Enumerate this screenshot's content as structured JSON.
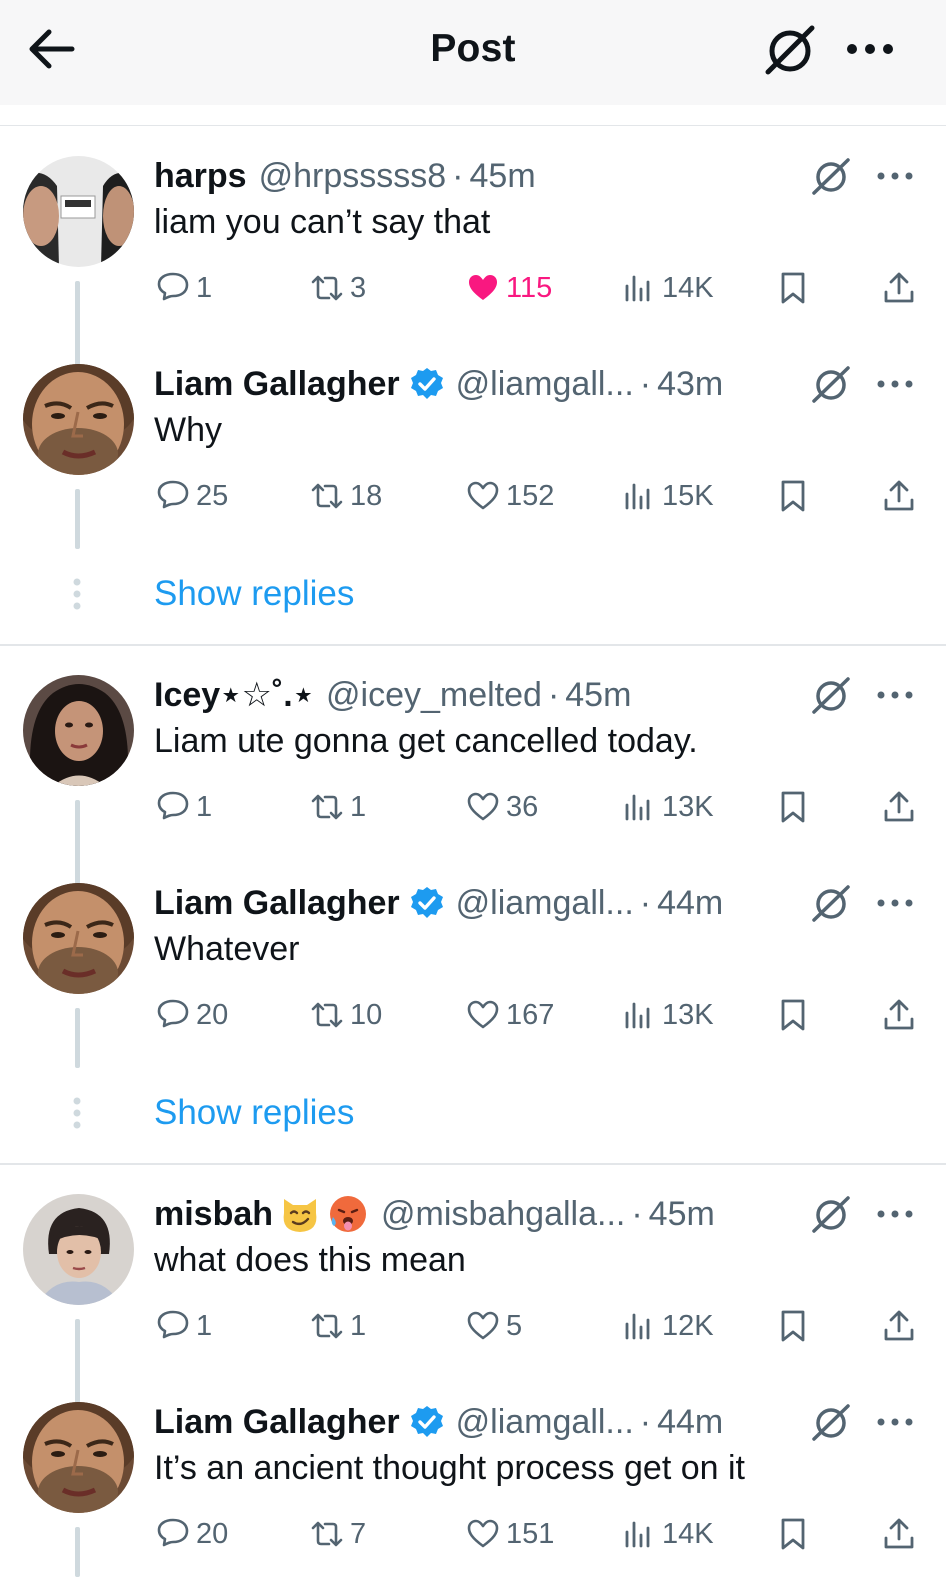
{
  "header": {
    "title": "Post"
  },
  "threads": [
    {
      "reply": {
        "name": "harps",
        "handle": "@hrpsssss8",
        "time": "45m",
        "text": "liam you can’t say that",
        "replies": "1",
        "reposts": "3",
        "likes": "115",
        "liked": true,
        "views": "14K",
        "avatar_badge": "oasis live '25"
      },
      "response": {
        "name": "Liam Gallagher",
        "handle": "@liamgall...",
        "time": "43m",
        "text": "Why",
        "replies": "25",
        "reposts": "18",
        "likes": "152",
        "views": "15K"
      },
      "show_replies": "Show replies"
    },
    {
      "reply": {
        "name": "Icey⋆☆˚.⋆",
        "handle": "@icey_melted",
        "time": "45m",
        "text": "Liam ute gonna get cancelled today.",
        "replies": "1",
        "reposts": "1",
        "likes": "36",
        "views": "13K"
      },
      "response": {
        "name": "Liam Gallagher",
        "handle": "@liamgall...",
        "time": "44m",
        "text": "Whatever",
        "replies": "20",
        "reposts": "10",
        "likes": "167",
        "views": "13K"
      },
      "show_replies": "Show replies"
    },
    {
      "reply": {
        "name": "misbah",
        "handle": "@misbahgalla...",
        "time": "45m",
        "text": "what does this mean",
        "replies": "1",
        "reposts": "1",
        "likes": "5",
        "views": "12K",
        "name_emojis": [
          "smirking-cat-emoji",
          "hot-face-emoji"
        ]
      },
      "response": {
        "name": "Liam Gallagher",
        "handle": "@liamgall...",
        "time": "44m",
        "text": "It’s an ancient thought process get on it",
        "replies": "20",
        "reposts": "7",
        "likes": "151",
        "views": "14K"
      }
    }
  ],
  "colors": {
    "link": "#1d9bf0",
    "like_active": "#f91880",
    "verified": "#1d9bf0",
    "muted_text": "#536471"
  }
}
